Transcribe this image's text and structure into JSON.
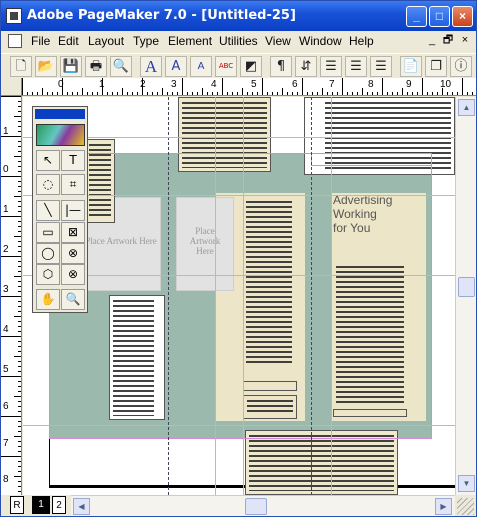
{
  "window": {
    "title": "Adobe PageMaker 7.0 - [Untitled-25]",
    "minimize": "_",
    "maximize": "□",
    "close": "×"
  },
  "menu": {
    "items": [
      "File",
      "Edit",
      "Layout",
      "Type",
      "Element",
      "Utilities",
      "View",
      "Window",
      "Help"
    ],
    "doc_controls": [
      "_",
      "🗗",
      "×"
    ]
  },
  "toolbar": {
    "buttons": [
      "new-icon",
      "open-icon",
      "save-icon",
      "print-icon",
      "find-icon",
      "type-icon",
      "font-larger-icon",
      "font-smaller-icon",
      "spelling-icon",
      "fill-icon",
      "paragraph-icon",
      "sort-icon",
      "indent-icon",
      "outdent-icon",
      "align-icon",
      "page-icon",
      "copy-icon",
      "info-icon"
    ],
    "glyphs": [
      "🗋",
      "📂",
      "💾",
      "🖶",
      "🔍",
      "A",
      "A",
      "A",
      "ABC",
      "◩",
      "¶",
      "⇵",
      "☰",
      "☰",
      "☰",
      "📄",
      "❐",
      "ⓘ"
    ]
  },
  "rulers": {
    "horizontal": [
      "0",
      "1",
      "2",
      "3",
      "4",
      "5",
      "6",
      "7",
      "8",
      "9",
      "10"
    ],
    "vertical": [
      "1",
      "0",
      "1",
      "2",
      "3",
      "4",
      "5",
      "6",
      "7",
      "8"
    ]
  },
  "layout": {
    "placeholders": [
      "Place Artwork Here",
      "Place Artwork Here"
    ],
    "headline": [
      "Advertising",
      "Working",
      "for You"
    ]
  },
  "toolbox": {
    "tools": [
      "pointer-tool",
      "text-tool",
      "rotate-tool",
      "crop-tool",
      "line-tool",
      "constrained-line-tool",
      "rectangle-tool",
      "rectangle-frame-tool",
      "ellipse-tool",
      "ellipse-frame-tool",
      "polygon-tool",
      "polygon-frame-tool",
      "hand-tool",
      "zoom-tool"
    ],
    "glyphs": [
      "↖",
      "T",
      "◌",
      "⌗",
      "╲",
      "|—",
      "▭",
      "⊠",
      "◯",
      "⊗",
      "⬡",
      "⊗",
      "✋",
      "🔍"
    ]
  },
  "page_tabs": {
    "master_label": "R",
    "pages": [
      "1",
      "2"
    ],
    "active_page": "1"
  },
  "colors": {
    "title_bar": "#0a3fc4",
    "bleed": "#9cb9ad",
    "column": "#ece5c7",
    "guide": "#6fd8d8",
    "margin": "#d48ad4"
  }
}
